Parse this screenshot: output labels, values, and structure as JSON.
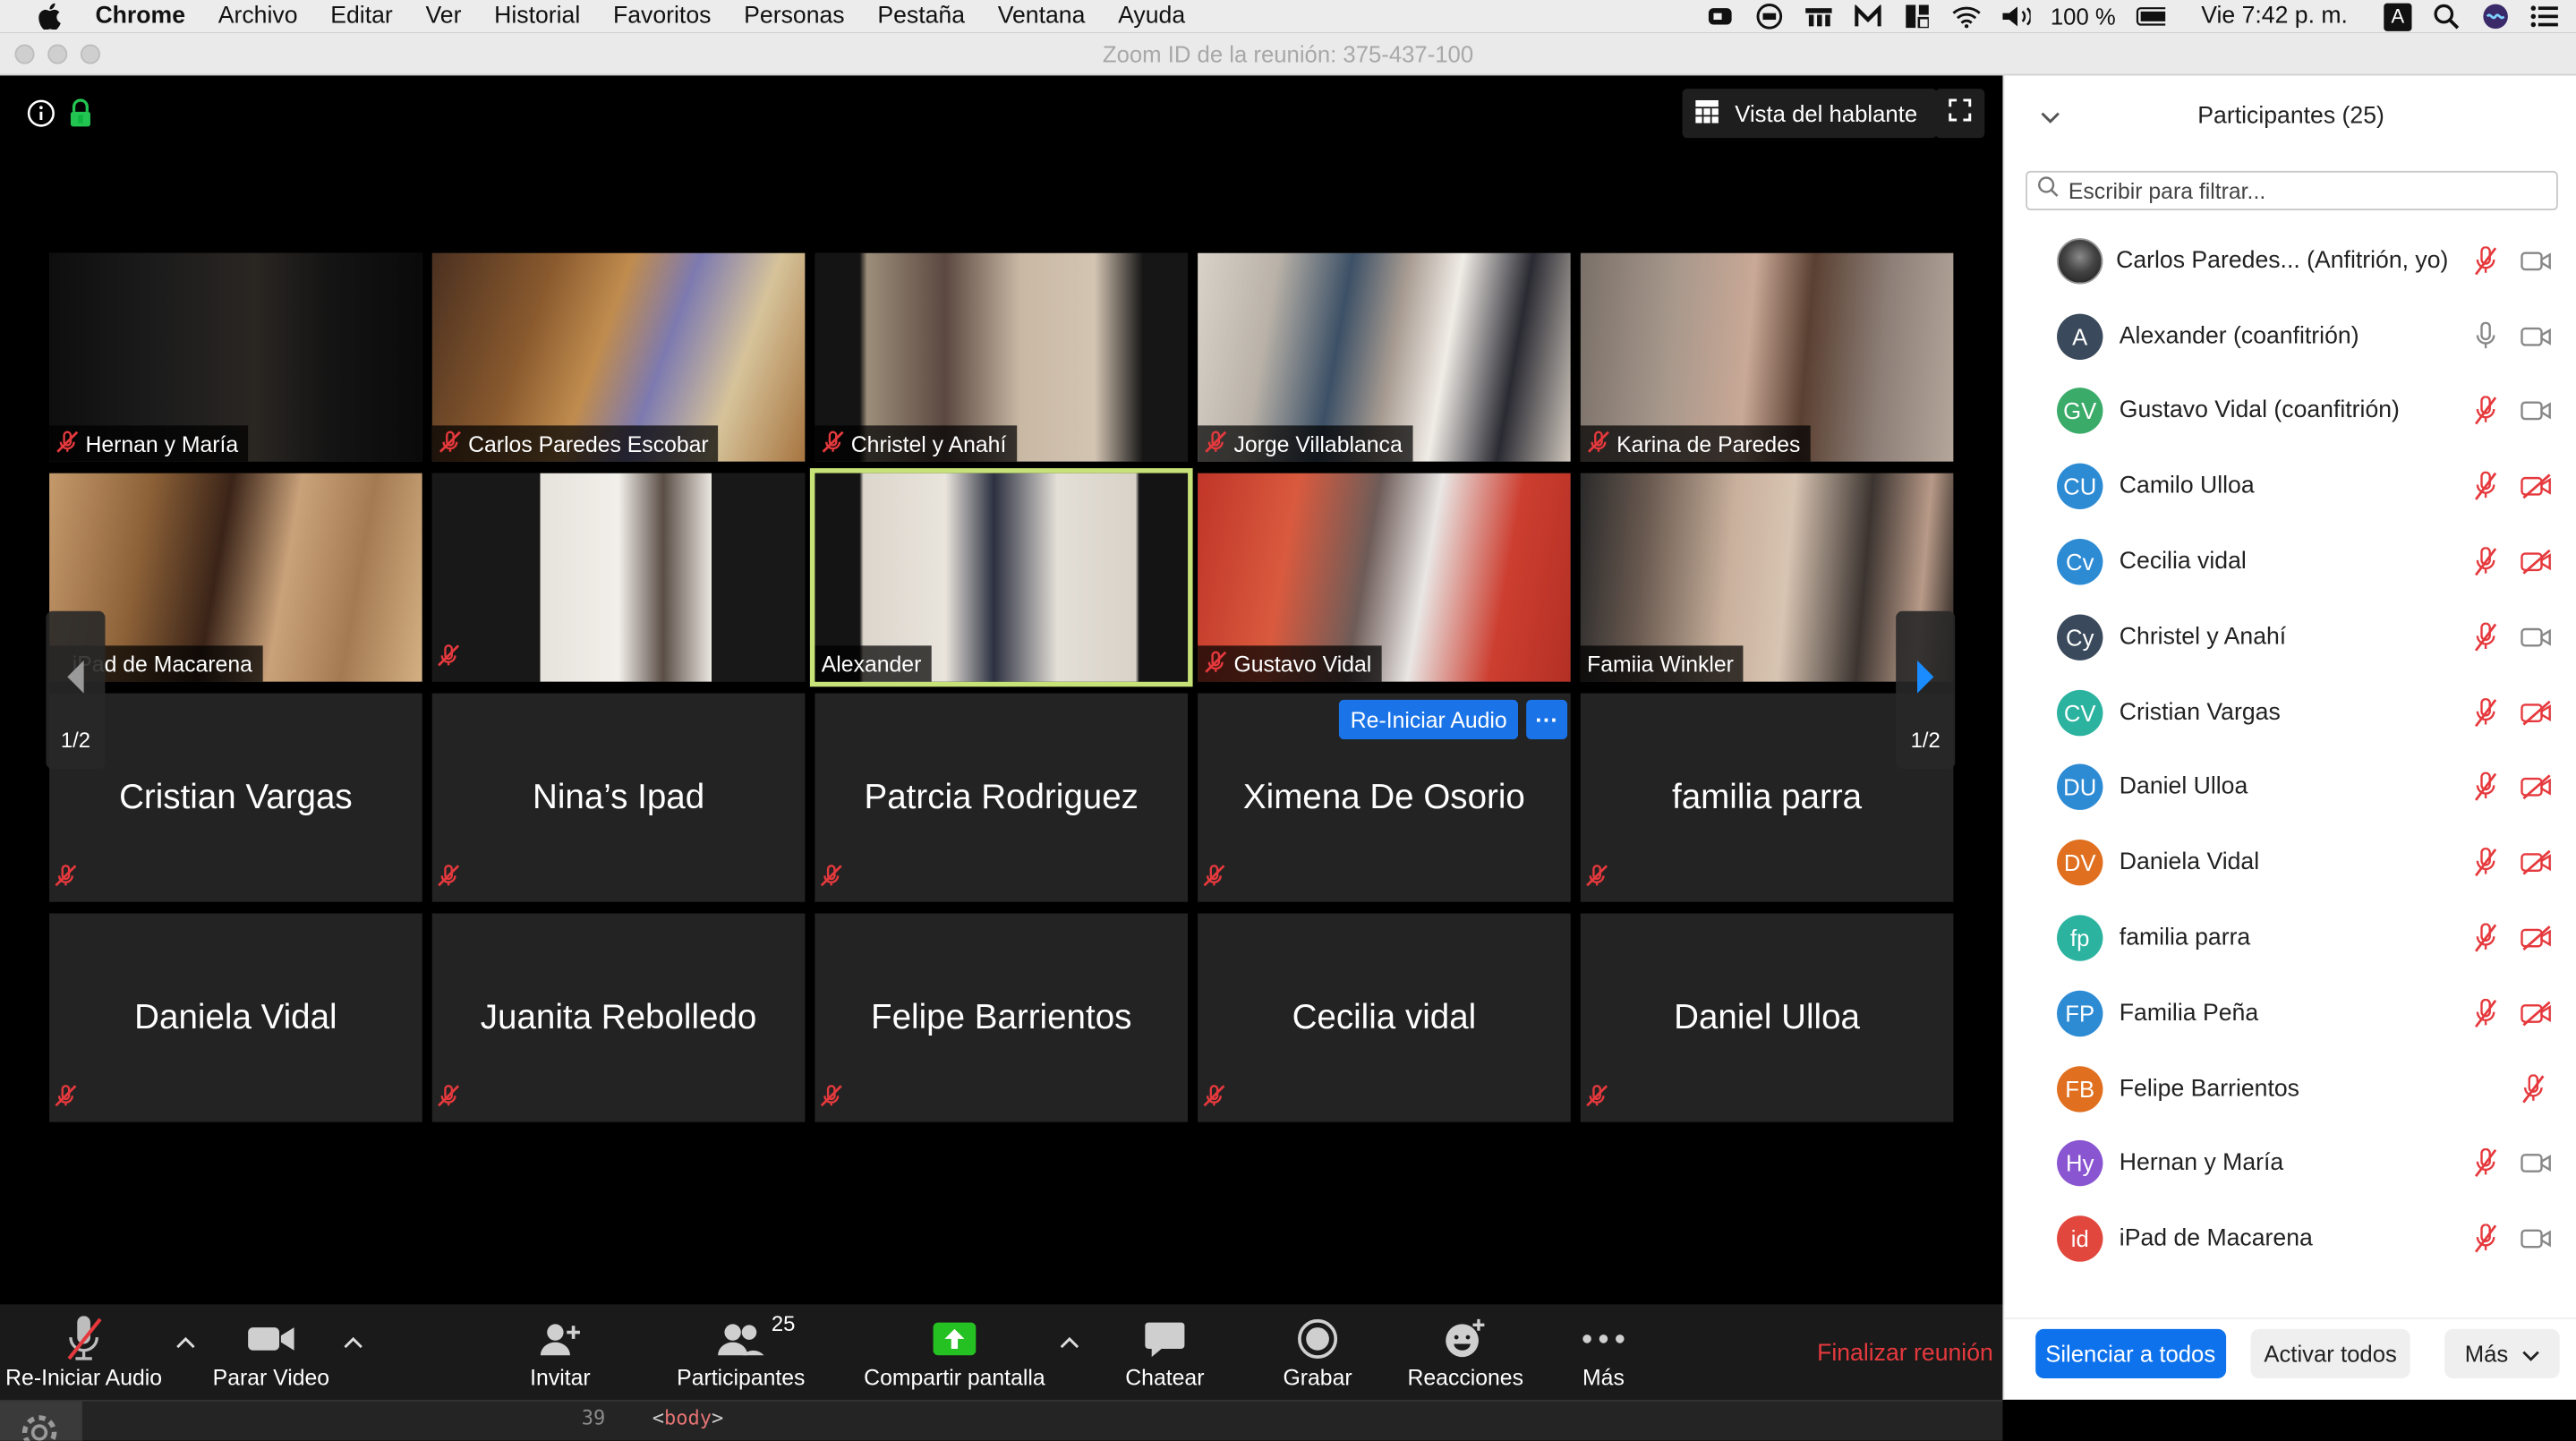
{
  "menubar": {
    "app": "Chrome",
    "items": [
      "Archivo",
      "Editar",
      "Ver",
      "Historial",
      "Favoritos",
      "Personas",
      "Pestaña",
      "Ventana",
      "Ayuda"
    ],
    "battery": "100 %",
    "clock": "Vie 7:42 p. m.",
    "input_source": "A"
  },
  "window": {
    "title": "Zoom ID de la reunión: 375-437-100"
  },
  "stage": {
    "view_button": "Vista del hablante",
    "page_indicator_left": "1/2",
    "page_indicator_right": "1/2",
    "reaudio_button": "Re-Iniciar Audio",
    "video_tiles": [
      {
        "name": "Hernan y María",
        "muted": true
      },
      {
        "name": "Carlos Paredes Escobar",
        "muted": true
      },
      {
        "name": "Christel y Anahí",
        "muted": true
      },
      {
        "name": "Jorge Villablanca",
        "muted": true
      },
      {
        "name": "Karina de Paredes",
        "muted": true
      },
      {
        "name": "iPad de Macarena",
        "muted": true
      },
      {
        "name": "",
        "muted": true
      },
      {
        "name": "Alexander",
        "muted": false,
        "active": true
      },
      {
        "name": "Gustavo Vidal",
        "muted": true
      },
      {
        "name": "Famiia Winkler",
        "muted": false
      }
    ],
    "name_tiles": [
      "Cristian Vargas",
      "Nina’s Ipad",
      "Patrcia Rodriguez",
      "Ximena De Osorio",
      "familia parra",
      "Daniela Vidal",
      "Juanita Rebolledo",
      "Felipe Barrientos",
      "Cecilia vidal",
      "Daniel Ulloa"
    ]
  },
  "toolbar": {
    "audio": "Re-Iniciar Audio",
    "video": "Parar Video",
    "invite": "Invitar",
    "participants": "Participantes",
    "participants_count": "25",
    "share": "Compartir pantalla",
    "chat": "Chatear",
    "record": "Grabar",
    "reactions": "Reacciones",
    "more": "Más",
    "end": "Finalizar reunión"
  },
  "devtools": {
    "line": "39",
    "code_open": "<",
    "tag": "body",
    "code_close": ">"
  },
  "panel": {
    "title": "Participantes (25)",
    "filter_placeholder": "Escribir para filtrar...",
    "participants": [
      {
        "initials": "",
        "name": "Carlos Paredes...  (Anfitrión, yo)",
        "color": "#333333",
        "mic": "muted",
        "cam": "on",
        "photo": true
      },
      {
        "initials": "A",
        "name": "Alexander (coanfitrión)",
        "color": "#3a4a5c",
        "mic": "on",
        "cam": "on"
      },
      {
        "initials": "GV",
        "name": "Gustavo Vidal (coanfitrión)",
        "color": "#3bab69",
        "mic": "muted",
        "cam": "on"
      },
      {
        "initials": "CU",
        "name": "Camilo Ulloa",
        "color": "#2d8bd4",
        "mic": "muted",
        "cam": "off"
      },
      {
        "initials": "Cv",
        "name": "Cecilia vidal",
        "color": "#2d8bd4",
        "mic": "muted",
        "cam": "off"
      },
      {
        "initials": "Cy",
        "name": "Christel y Anahí",
        "color": "#3a4a5c",
        "mic": "muted",
        "cam": "on"
      },
      {
        "initials": "CV",
        "name": "Cristian Vargas",
        "color": "#2bb3a0",
        "mic": "muted",
        "cam": "off"
      },
      {
        "initials": "DU",
        "name": "Daniel Ulloa",
        "color": "#2d8bd4",
        "mic": "muted",
        "cam": "off"
      },
      {
        "initials": "DV",
        "name": "Daniela Vidal",
        "color": "#e0701f",
        "mic": "muted",
        "cam": "off"
      },
      {
        "initials": "fp",
        "name": "familia parra",
        "color": "#2bb3a0",
        "mic": "muted",
        "cam": "off"
      },
      {
        "initials": "FP",
        "name": "Familia Peña",
        "color": "#2d8bd4",
        "mic": "muted",
        "cam": "off"
      },
      {
        "initials": "FB",
        "name": "Felipe Barrientos",
        "color": "#e0701f",
        "mic": "muted",
        "cam": "none"
      },
      {
        "initials": "Hy",
        "name": "Hernan y María",
        "color": "#8a55d0",
        "mic": "muted",
        "cam": "on"
      },
      {
        "initials": "id",
        "name": "iPad de Macarena",
        "color": "#e1473d",
        "mic": "muted",
        "cam": "on"
      }
    ],
    "mute_all": "Silenciar a todos",
    "unmute_all": "Activar todos",
    "more": "Más"
  }
}
